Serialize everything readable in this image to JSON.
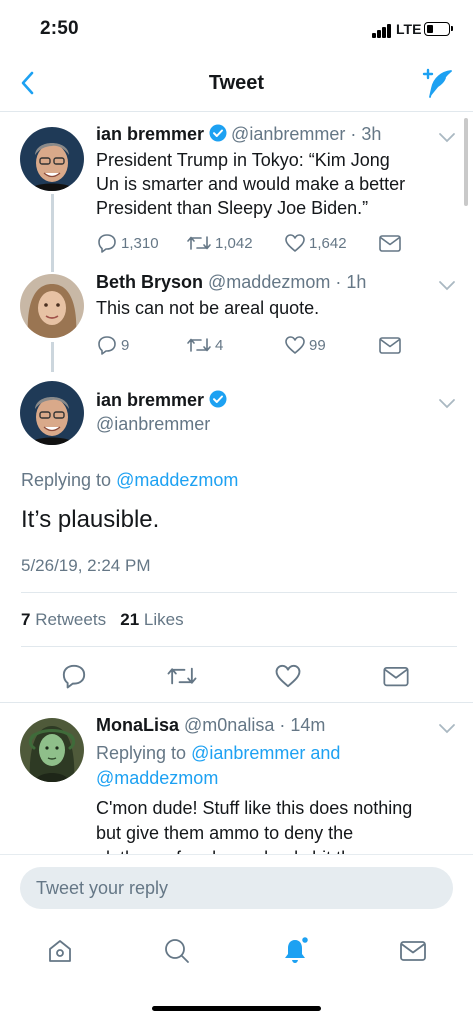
{
  "status_bar": {
    "time": "2:50",
    "network": "LTE",
    "battery_level": 0.3
  },
  "nav": {
    "title": "Tweet",
    "back_icon": "chevron-left-icon",
    "compose_icon": "compose-tweet-icon"
  },
  "colors": {
    "accent": "#1da1f2",
    "text": "#14171a",
    "muted": "#657786",
    "divider": "#e1e8ed"
  },
  "tweet1": {
    "name": "ian bremmer",
    "handle": "@ianbremmer",
    "time": "3h",
    "lines": [
      "President Trump in Tokyo: “Kim Jong",
      "Un is smarter and would make a better",
      "President than Sleepy Joe Biden.”"
    ],
    "replies": "1,310",
    "retweets": "1,042",
    "likes": "1,642"
  },
  "tweet2": {
    "name": "Beth Bryson",
    "handle": "@maddezmom",
    "time": "1h",
    "text": "This can not be areal quote.",
    "replies": "9",
    "retweets": "4",
    "likes": "99"
  },
  "focus": {
    "name": "ian bremmer",
    "handle": "@ianbremmer",
    "replying_label": "Replying to",
    "replying_to": "@maddezmom",
    "text": "It’s plausible.",
    "date": "5/26/19, 2:24 PM",
    "retweets_count": "7",
    "retweets_label": "Retweets",
    "likes_count": "21",
    "likes_label": "Likes"
  },
  "reply3": {
    "name": "MonaLisa",
    "handle": "@m0nalisa",
    "time": "14m",
    "replying_label": "Replying to",
    "replying_to_1": "@ianbremmer",
    "and": "and",
    "replying_to_2": "@maddezmom",
    "lines": [
      "C'mon dude! Stuff like this does nothing",
      "but give them ammo to deny the",
      "plethora of real crazyland shit these"
    ]
  },
  "reply_bar": {
    "placeholder": "Tweet your reply"
  },
  "tabs": [
    "home-icon",
    "search-icon",
    "notifications-icon",
    "messages-icon"
  ]
}
